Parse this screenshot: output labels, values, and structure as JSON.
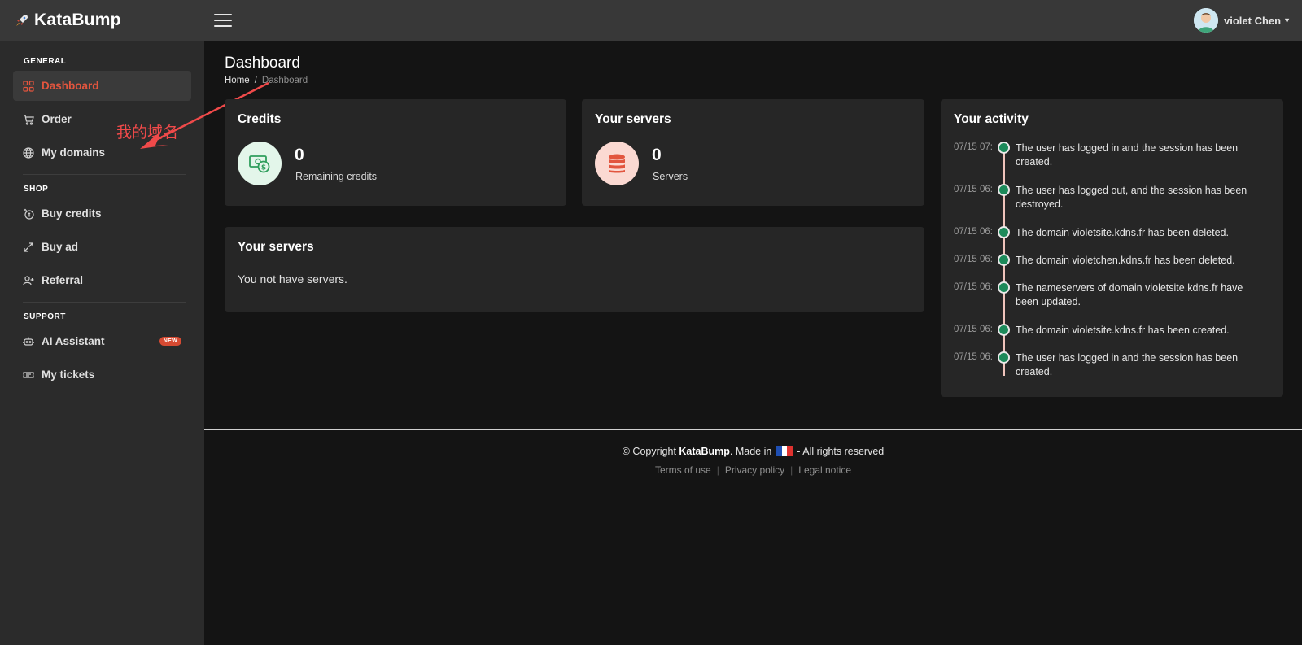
{
  "app": {
    "name": "KataBump"
  },
  "header": {
    "user_name": "violet Chen"
  },
  "sidebar": {
    "sections": [
      {
        "title": "GENERAL",
        "items": [
          {
            "label": "Dashboard",
            "icon": "grid-icon",
            "active": true
          },
          {
            "label": "Order",
            "icon": "cart-icon"
          },
          {
            "label": "My domains",
            "icon": "globe-icon"
          }
        ]
      },
      {
        "title": "SHOP",
        "items": [
          {
            "label": "Buy credits",
            "icon": "coin-icon"
          },
          {
            "label": "Buy ad",
            "icon": "expand-icon"
          },
          {
            "label": "Referral",
            "icon": "user-plus-icon"
          }
        ]
      },
      {
        "title": "SUPPORT",
        "items": [
          {
            "label": "AI Assistant",
            "icon": "robot-icon",
            "badge": "NEW"
          },
          {
            "label": "My tickets",
            "icon": "ticket-icon"
          }
        ]
      }
    ]
  },
  "annotation": {
    "text": "我的域名",
    "color": "#f04a4a"
  },
  "page": {
    "title": "Dashboard",
    "breadcrumb": {
      "home": "Home",
      "separator": "/",
      "current": "Dashboard"
    }
  },
  "cards": {
    "credits": {
      "title": "Credits",
      "value": "0",
      "label": "Remaining credits",
      "icon": "money-icon"
    },
    "servers_stat": {
      "title": "Your servers",
      "value": "0",
      "label": "Servers",
      "icon": "database-icon"
    },
    "servers_list": {
      "title": "Your servers",
      "empty_text": "You not have servers."
    }
  },
  "activity": {
    "title": "Your activity",
    "items": [
      {
        "time": "07/15 07:",
        "text": "The user has logged in and the session has been created."
      },
      {
        "time": "07/15 06:",
        "text": "The user has logged out, and the session has been destroyed."
      },
      {
        "time": "07/15 06:",
        "text": "The domain violetsite.kdns.fr has been deleted."
      },
      {
        "time": "07/15 06:",
        "text": "The domain violetchen.kdns.fr has been deleted."
      },
      {
        "time": "07/15 06:",
        "text": "The nameservers of domain violetsite.kdns.fr have been updated."
      },
      {
        "time": "07/15 06:",
        "text": "The domain violetsite.kdns.fr has been created."
      },
      {
        "time": "07/15 06:",
        "text": "The user has logged in and the session has been created."
      }
    ]
  },
  "footer": {
    "copyright_prefix": "© Copyright ",
    "brand": "KataBump",
    "made_in": ". Made in ",
    "suffix": " - All rights reserved",
    "links": [
      "Terms of use",
      "Privacy policy",
      "Legal notice"
    ]
  },
  "colors": {
    "accent": "#e2553e",
    "sidebar_bg": "#2b2b2b",
    "header_bg": "#383838",
    "card_bg": "#262626",
    "dot_green": "#1c8a5a"
  }
}
